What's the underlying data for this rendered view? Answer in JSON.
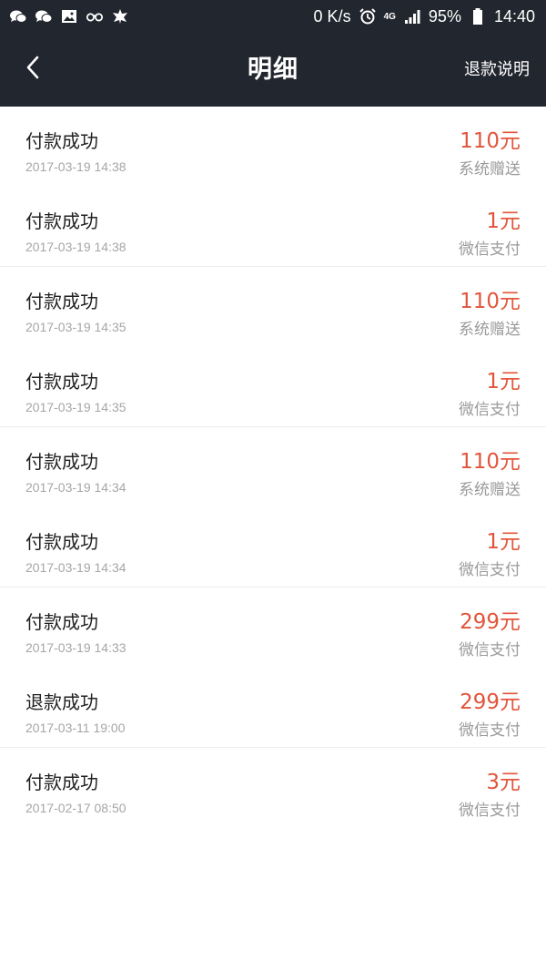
{
  "status_bar": {
    "net_speed": "0 K/s",
    "network": "4G",
    "battery": "95%",
    "time": "14:40",
    "icons": [
      "wechat-icon",
      "wechat-icon",
      "image-icon",
      "glasses-icon",
      "leaf-icon",
      "alarm-icon",
      "signal-icon",
      "battery-icon"
    ]
  },
  "nav": {
    "title": "明细",
    "action": "退款说明",
    "back_icon": "chevron-left-icon"
  },
  "transactions": [
    {
      "title": "付款成功",
      "time": "2017-03-19 14:38",
      "amount": "110元",
      "method": "系统赠送"
    },
    {
      "title": "付款成功",
      "time": "2017-03-19 14:38",
      "amount": "1元",
      "method": "微信支付"
    },
    {
      "title": "付款成功",
      "time": "2017-03-19 14:35",
      "amount": "110元",
      "method": "系统赠送"
    },
    {
      "title": "付款成功",
      "time": "2017-03-19 14:35",
      "amount": "1元",
      "method": "微信支付"
    },
    {
      "title": "付款成功",
      "time": "2017-03-19 14:34",
      "amount": "110元",
      "method": "系统赠送"
    },
    {
      "title": "付款成功",
      "time": "2017-03-19 14:34",
      "amount": "1元",
      "method": "微信支付"
    },
    {
      "title": "付款成功",
      "time": "2017-03-19 14:33",
      "amount": "299元",
      "method": "微信支付"
    },
    {
      "title": "退款成功",
      "time": "2017-03-11 19:00",
      "amount": "299元",
      "method": "微信支付"
    },
    {
      "title": "付款成功",
      "time": "2017-02-17 08:50",
      "amount": "3元",
      "method": "微信支付"
    }
  ],
  "colors": {
    "header_bg": "#22262e",
    "amount": "#e2553b",
    "secondary_text": "#9a9a9a"
  }
}
